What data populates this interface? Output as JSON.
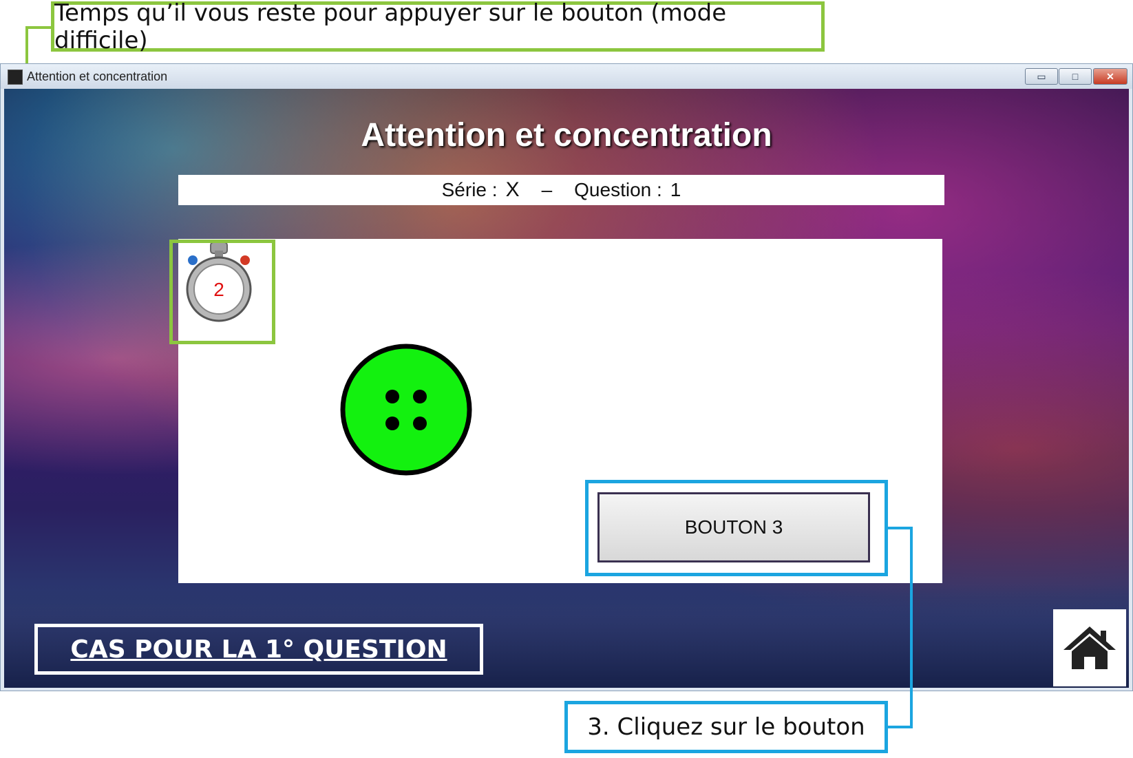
{
  "annotations": {
    "top_note": "Temps qu’il vous reste pour appuyer sur le bouton (mode difficile)",
    "bottom_note": "3. Cliquez sur le bouton",
    "case_label": "CAS POUR LA 1° QUESTION"
  },
  "window": {
    "title": "Attention et concentration",
    "minimize_glyph": "▭",
    "maximize_glyph": "□",
    "close_glyph": "✕"
  },
  "app": {
    "heading": "Attention et concentration",
    "serie_label": "Série :",
    "serie_value": "X",
    "separator": "–",
    "question_label": "Question :",
    "question_value": "1",
    "timer_value": "2",
    "target_color": "#13f10f",
    "action_button": "BOUTON 3",
    "home_icon": "home-icon"
  },
  "colors": {
    "green_highlight": "#8cc63f",
    "blue_highlight": "#1ba5e0"
  }
}
